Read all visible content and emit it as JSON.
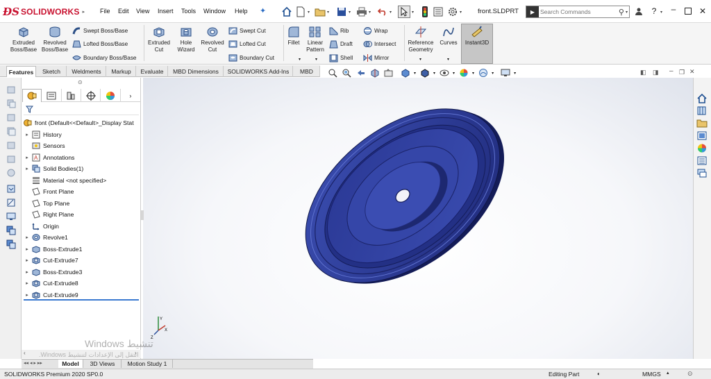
{
  "app": {
    "logo_text": "SOLIDWORKS",
    "menu": [
      "File",
      "Edit",
      "View",
      "Insert",
      "Tools",
      "Window",
      "Help"
    ],
    "document_title": "front.SLDPRT",
    "search_placeholder": "Search Commands"
  },
  "command_manager": {
    "extruded_boss": "Extruded Boss/Base",
    "revolved_boss": "Revolved Boss/Base",
    "swept_boss": "Swept Boss/Base",
    "lofted_boss": "Lofted Boss/Base",
    "boundary_boss": "Boundary Boss/Base",
    "extruded_cut": "Extruded Cut",
    "hole_wizard": "Hole Wizard",
    "revolved_cut": "Revolved Cut",
    "swept_cut": "Swept Cut",
    "lofted_cut": "Lofted Cut",
    "boundary_cut": "Boundary Cut",
    "fillet": "Fillet",
    "linear_pattern": "Linear Pattern",
    "rib": "Rib",
    "draft": "Draft",
    "shell": "Shell",
    "wrap": "Wrap",
    "intersect": "Intersect",
    "mirror": "Mirror",
    "reference_geometry": "Reference Geometry",
    "curves": "Curves",
    "instant3d": "Instant3D"
  },
  "cm_tabs": [
    "Features",
    "Sketch",
    "Weldments",
    "Markup",
    "Evaluate",
    "MBD Dimensions",
    "SOLIDWORKS Add-Ins",
    "MBD"
  ],
  "feature_tree": {
    "root": "front  (Default<<Default>_Display Stat",
    "items": [
      {
        "label": "History",
        "icon": "history-icon",
        "expandable": true
      },
      {
        "label": "Sensors",
        "icon": "sensors-icon",
        "expandable": false
      },
      {
        "label": "Annotations",
        "icon": "annotations-icon",
        "expandable": true
      },
      {
        "label": "Solid Bodies(1)",
        "icon": "solid-bodies-icon",
        "expandable": true
      },
      {
        "label": "Material <not specified>",
        "icon": "material-icon",
        "expandable": false
      },
      {
        "label": "Front Plane",
        "icon": "plane-icon",
        "expandable": false
      },
      {
        "label": "Top Plane",
        "icon": "plane-icon",
        "expandable": false
      },
      {
        "label": "Right Plane",
        "icon": "plane-icon",
        "expandable": false
      },
      {
        "label": "Origin",
        "icon": "origin-icon",
        "expandable": false
      },
      {
        "label": "Revolve1",
        "icon": "revolve-icon",
        "expandable": true
      },
      {
        "label": "Boss-Extrude1",
        "icon": "extrude-icon",
        "expandable": true
      },
      {
        "label": "Cut-Extrude7",
        "icon": "cut-extrude-icon",
        "expandable": true
      },
      {
        "label": "Boss-Extrude3",
        "icon": "extrude-icon",
        "expandable": true
      },
      {
        "label": "Cut-Extrude8",
        "icon": "cut-extrude-icon",
        "expandable": true
      },
      {
        "label": "Cut-Extrude9",
        "icon": "cut-extrude-icon",
        "expandable": true
      }
    ]
  },
  "model_tabs": [
    "Model",
    "3D Views",
    "Motion Study 1"
  ],
  "status": {
    "version": "SOLIDWORKS Premium 2020 SP0.0",
    "mode": "Editing Part",
    "units": "MMGS"
  },
  "watermark": {
    "line1": "Windows تنشيط",
    "line2": "انتقل إلى الإعدادات لتنشيط Windows."
  },
  "colors": {
    "part_fill": "#2d3d9a",
    "part_dark": "#1c2670",
    "part_light": "#4a5cc0",
    "brand_red": "#c8102e"
  }
}
